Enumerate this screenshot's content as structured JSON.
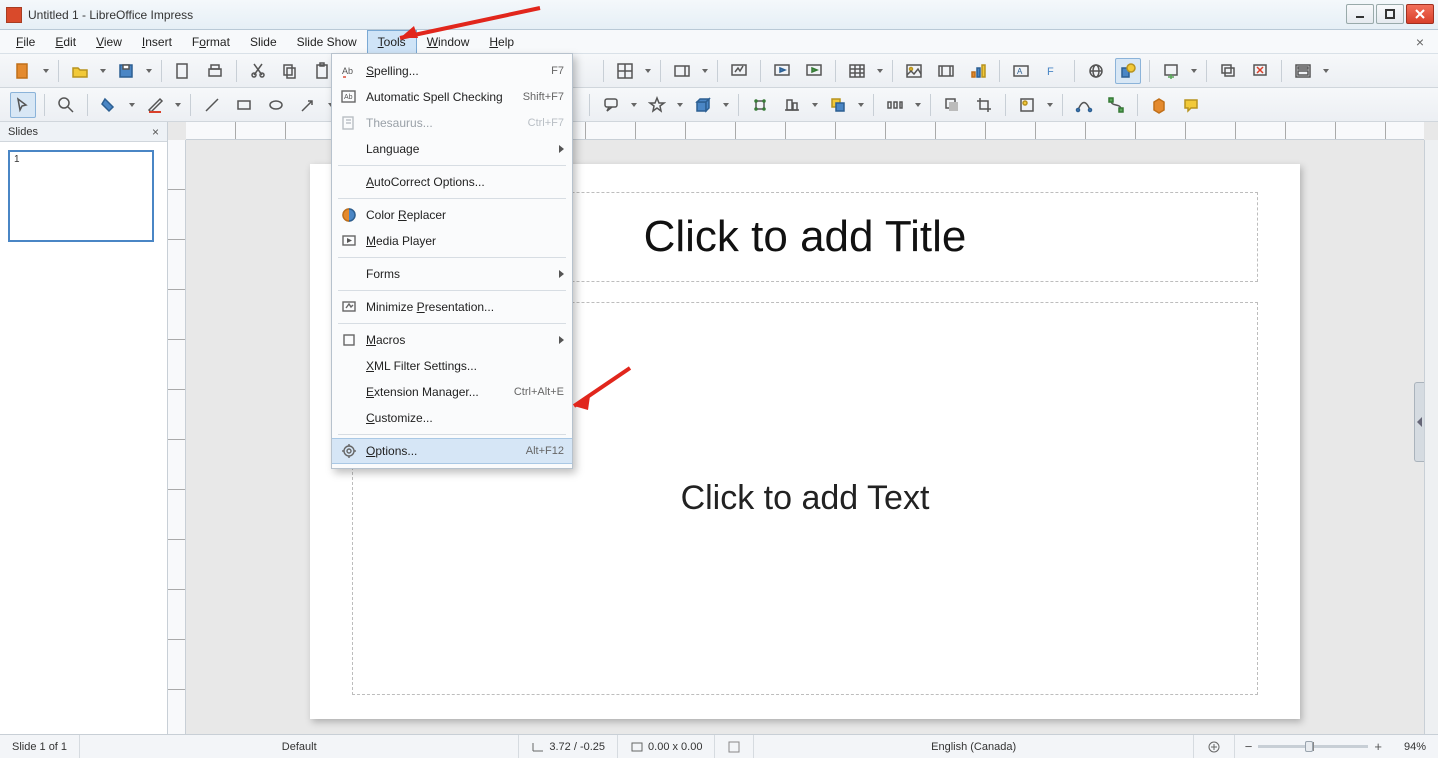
{
  "window": {
    "title": "Untitled 1 - LibreOffice Impress"
  },
  "menubar": {
    "file": "File",
    "file_u": "F",
    "edit": "Edit",
    "edit_u": "E",
    "view": "View",
    "view_u": "V",
    "insert": "Insert",
    "insert_u": "I",
    "format": "Format",
    "format_u": "o",
    "slide": "Slide",
    "slide_u": "S",
    "slideshow": "Slide Show",
    "slideshow_u": "S",
    "tools": "Tools",
    "tools_u": "T",
    "window": "Window",
    "window_u": "W",
    "help": "Help",
    "help_u": "H"
  },
  "tools_menu": {
    "spelling": {
      "label": "Spelling...",
      "shortcut": "F7"
    },
    "auto_spell": {
      "label": "Automatic Spell Checking",
      "shortcut": "Shift+F7"
    },
    "thesaurus": {
      "label": "Thesaurus...",
      "shortcut": "Ctrl+F7"
    },
    "language": {
      "label": "Language"
    },
    "autocorrect": {
      "label": "AutoCorrect Options..."
    },
    "color_replacer": {
      "label": "Color Replacer"
    },
    "media_player": {
      "label": "Media Player"
    },
    "forms": {
      "label": "Forms"
    },
    "minimize": {
      "label": "Minimize Presentation..."
    },
    "macros": {
      "label": "Macros"
    },
    "xml_filter": {
      "label": "XML Filter Settings..."
    },
    "ext_mgr": {
      "label": "Extension Manager...",
      "shortcut": "Ctrl+Alt+E"
    },
    "customize": {
      "label": "Customize..."
    },
    "options": {
      "label": "Options...",
      "shortcut": "Alt+F12"
    }
  },
  "panel": {
    "title": "Slides",
    "slide1_num": "1"
  },
  "slide": {
    "title_placeholder": "Click to add Title",
    "text_placeholder": "Click to add Text"
  },
  "status": {
    "slide_n": "Slide 1 of 1",
    "master": "Default",
    "cursor": "3.72 / -0.25",
    "size": "0.00 x 0.00",
    "lang": "English (Canada)",
    "zoom_pct": "94%"
  }
}
